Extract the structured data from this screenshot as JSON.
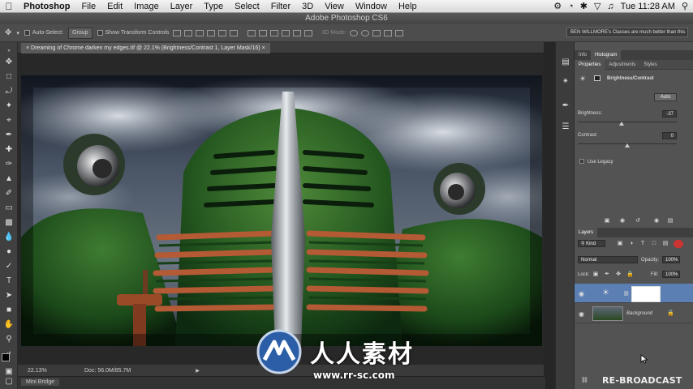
{
  "menubar": {
    "app": "Photoshop",
    "items": [
      "File",
      "Edit",
      "Image",
      "Layer",
      "Type",
      "Select",
      "Filter",
      "3D",
      "View",
      "Window",
      "Help"
    ],
    "clock": "Tue 11:28 AM"
  },
  "window_title": "Adobe Photoshop CS6",
  "options_bar": {
    "auto_select_label": "Auto-Select:",
    "auto_select_value": "Group",
    "transform_label": "Show Transform Controls",
    "mode_3d": "3D Mode:",
    "notice": "BEN WILLMORE's Classes are much better than this"
  },
  "document_tab": {
    "title": "Dreaming of Chrome darken my edges.tif @ 22.1% (Brightness/Contrast 1, Layer Mask/16)",
    "close": "×"
  },
  "status_bar": {
    "zoom": "22.13%",
    "doc": "Doc: 56.0M/85.7M"
  },
  "mini_bridge_tab": "Mini Bridge",
  "panels": {
    "top_tabs": [
      "Info",
      "Histogram"
    ],
    "sub_tabs": [
      "Properties",
      "Adjustments",
      "Styles"
    ],
    "adjustment_title": "Brightness/Contrast",
    "auto_button": "Auto",
    "brightness_label": "Brightness:",
    "brightness_value": "-37",
    "brightness_fraction": 0.44,
    "contrast_label": "Contrast:",
    "contrast_value": "0",
    "contrast_fraction": 0.5,
    "use_legacy_label": "Use Legacy",
    "layers_tab": "Layers",
    "kind_label": "Kind",
    "blend_mode": "Normal",
    "opacity_label": "Opacity:",
    "opacity_value": "100%",
    "lock_label": "Lock:",
    "fill_label": "Fill:",
    "fill_value": "100%",
    "layers": [
      {
        "name": "",
        "type": "adjustment"
      },
      {
        "name": "Background",
        "type": "image"
      }
    ]
  },
  "watermark": {
    "title": "人人素材",
    "url": "www.rr-sc.com"
  },
  "broadcast_label": "RE-BROADCAST",
  "colors": {
    "ui_dark": "#262626",
    "panel": "#535353",
    "layer_selected": "#5b7fb3"
  }
}
